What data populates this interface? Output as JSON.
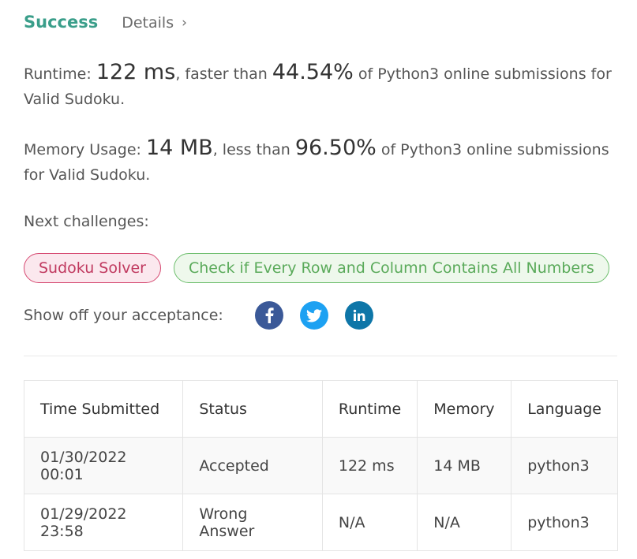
{
  "header": {
    "status": "Success",
    "details_link": "Details",
    "chevron": "›"
  },
  "runtime": {
    "label": "Runtime: ",
    "value": "122 ms",
    "comparison": ", faster than ",
    "percent": "44.54%",
    "suffix": " of Python3 online submissions for Valid Sudoku."
  },
  "memory": {
    "label": "Memory Usage: ",
    "value": "14 MB",
    "comparison": ", less than ",
    "percent": "96.50%",
    "suffix": " of Python3 online submissions for Valid Sudoku."
  },
  "next": {
    "label": "Next challenges:",
    "challenges": [
      {
        "title": "Sudoku Solver",
        "difficulty_color": "#c0395f"
      },
      {
        "title": "Check if Every Row and Column Contains All Numbers",
        "difficulty_color": "#5aaa5a"
      }
    ]
  },
  "share": {
    "label": "Show off your acceptance:",
    "icons": [
      "facebook-icon",
      "twitter-icon",
      "linkedin-icon"
    ]
  },
  "colors": {
    "success": "#3a9e8a",
    "wrong": "#c0392b",
    "facebook": "#3b5998",
    "twitter": "#1da1f2",
    "linkedin": "#0e76a8"
  },
  "table": {
    "headers": [
      "Time Submitted",
      "Status",
      "Runtime",
      "Memory",
      "Language"
    ],
    "rows": [
      {
        "time": "01/30/2022 00:01",
        "status": "Accepted",
        "runtime": "122 ms",
        "memory": "14 MB",
        "language": "python3"
      },
      {
        "time": "01/29/2022 23:58",
        "status": "Wrong Answer",
        "runtime": "N/A",
        "memory": "N/A",
        "language": "python3"
      }
    ]
  }
}
